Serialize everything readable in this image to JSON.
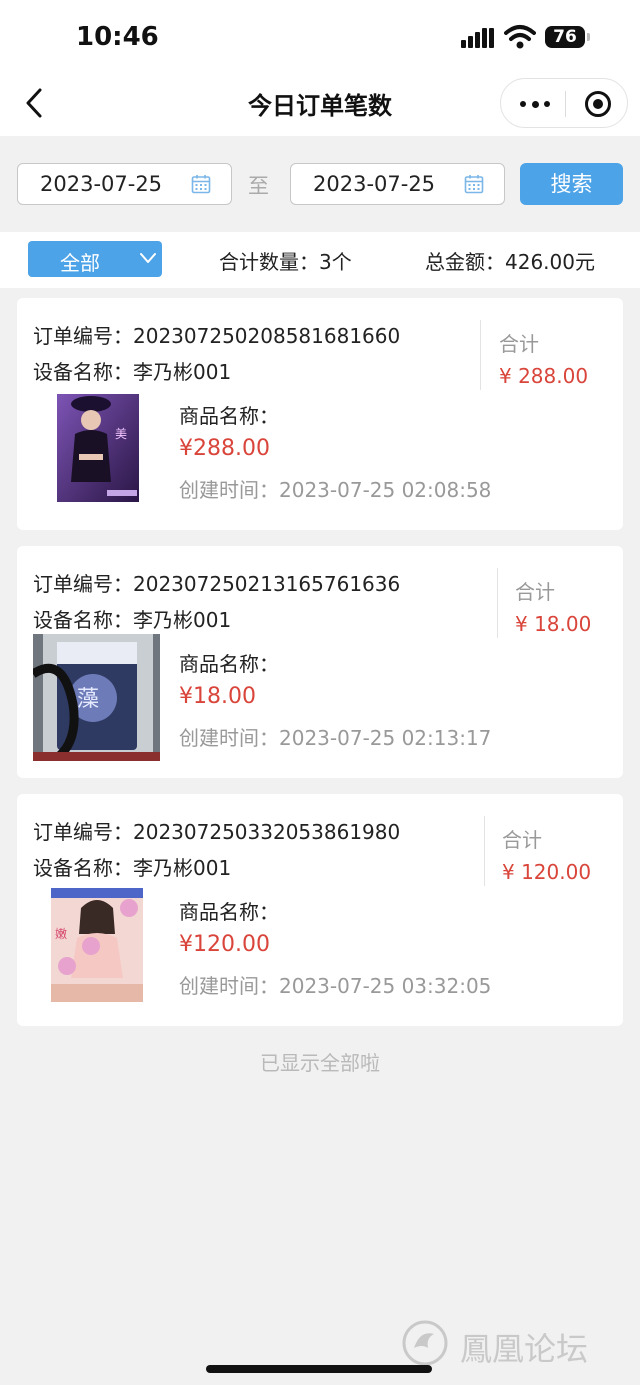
{
  "status_bar": {
    "time": "10:46",
    "battery": "76"
  },
  "nav": {
    "title": "今日订单笔数"
  },
  "filter": {
    "start_date": "2023-07-25",
    "end_date": "2023-07-25",
    "to_label": "至",
    "search_label": "搜索"
  },
  "summary": {
    "dropdown_value": "全部",
    "count_text": "合计数量：3个",
    "amount_text": "总金额：426.00元"
  },
  "orders": [
    {
      "order_no": "订单编号：20230725020858168166​0",
      "device": "设备名称：李乃彬001",
      "total_label": "合计",
      "total_value": "¥ 288.00",
      "product_label": "商品名称：",
      "price": "¥288.00",
      "created": "创建时间：2023-07-25 02:08:58"
    },
    {
      "order_no": "订单编号：20230725021316576163​6",
      "device": "设备名称：李乃彬001",
      "total_label": "合计",
      "total_value": "¥ 18.00",
      "product_label": "商品名称：",
      "price": "¥18.00",
      "created": "创建时间：2023-07-25 02:13:17"
    },
    {
      "order_no": "订单编号：20230725033205386198​0",
      "device": "设备名称：李乃彬001",
      "total_label": "合计",
      "total_value": "¥ 120.00",
      "product_label": "商品名称：",
      "price": "¥120.00",
      "created": "创建时间：2023-07-25 03:32:05"
    }
  ],
  "footer_note": "已显示全部啦",
  "watermark": "鳳凰论坛",
  "colors": {
    "accent": "#4da3e8",
    "price": "#d9453a",
    "muted": "#999999"
  },
  "icons": [
    "back-chevron-icon",
    "more-dots-icon",
    "target-icon",
    "calendar-icon",
    "chevron-down-icon"
  ]
}
